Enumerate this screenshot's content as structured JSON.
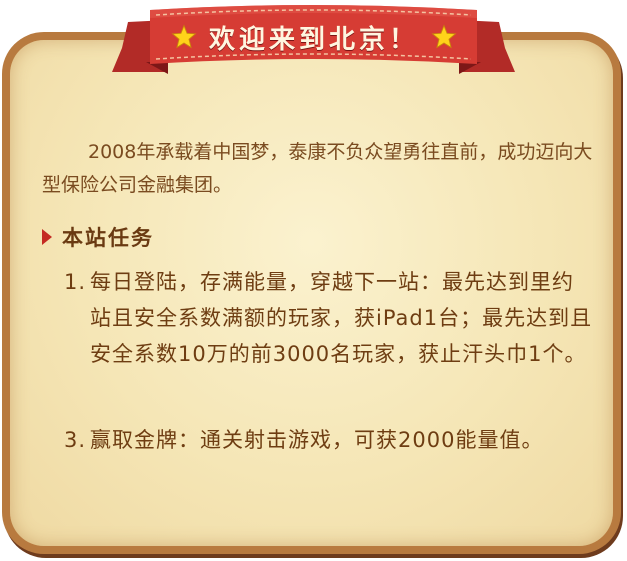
{
  "banner": {
    "title": "欢迎来到北京！",
    "left_icon": "star-icon",
    "right_icon": "star-icon",
    "colors": {
      "ribbon": "#cf3a33",
      "ribbon_dark": "#8f1d1d",
      "star": "#ffd21a"
    }
  },
  "intro": {
    "text": "2008年承载着中国梦，泰康不负众望勇往直前，成功迈向大型保险公司金融集团。"
  },
  "section": {
    "title": "本站任务",
    "marker_icon": "triangle-bullet-icon"
  },
  "tasks": [
    {
      "num": "1.",
      "text": "每日登陆，存满能量，穿越下一站：最先达到里约站且安全系数满额的玩家，获iPad1台；最先达到且安全系数10万的前3000名玩家，获止汗头巾1个。"
    },
    {
      "num": "3.",
      "text": "赢取金牌：通关射击游戏，可获2000能量值。"
    }
  ],
  "colors": {
    "panel_bg": "#f5e6b6",
    "panel_border": "#b87a3f",
    "text": "#7a4b20"
  }
}
